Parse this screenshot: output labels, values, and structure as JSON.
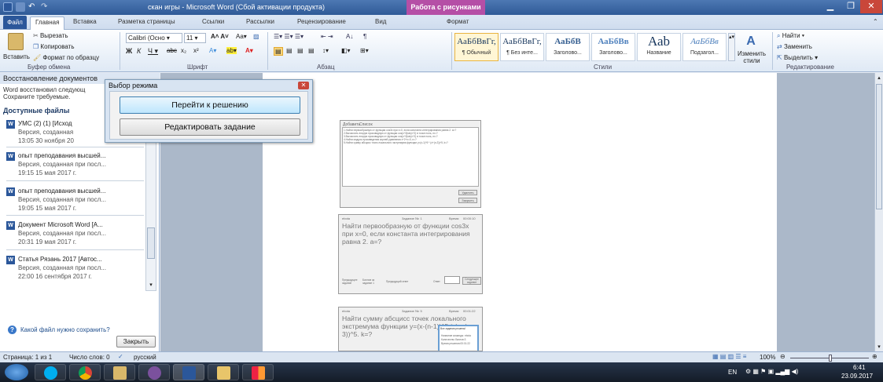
{
  "window": {
    "title": "скан игры - Microsoft Word (Сбой активации продукта)",
    "context_tab": "Работа с рисунками"
  },
  "tabs": [
    "Файл",
    "Главная",
    "Вставка",
    "Разметка страницы",
    "Ссылки",
    "Рассылки",
    "Рецензирование",
    "Вид",
    "Формат"
  ],
  "clipboard": {
    "paste": "Вставить",
    "cut": "Вырезать",
    "copy": "Копировать",
    "format_painter": "Формат по образцу",
    "label": "Буфер обмена"
  },
  "font": {
    "name": "Calibri (Осно",
    "size": "11",
    "label": "Шрифт"
  },
  "paragraph": {
    "label": "Абзац"
  },
  "styles": {
    "items": [
      {
        "sample": "АаБбВвГг,",
        "name": "¶ Обычный"
      },
      {
        "sample": "АаБбВвГг,",
        "name": "¶ Без инте..."
      },
      {
        "sample": "АаБбВ",
        "name": "Заголово..."
      },
      {
        "sample": "АаБбВв",
        "name": "Заголово..."
      },
      {
        "sample": "Ааb",
        "name": "Название"
      },
      {
        "sample": "АаБбВв",
        "name": "Подзагол..."
      }
    ],
    "change": "Изменить стили",
    "label": "Стили"
  },
  "editing": {
    "find": "Найти",
    "replace": "Заменить",
    "select": "Выделить",
    "label": "Редактирование"
  },
  "recovery": {
    "title": "Восстановление документов",
    "desc1": "Word восстановил следующ",
    "desc2": "Сохраните требуемые.",
    "available": "Доступные файлы",
    "files": [
      {
        "name": "УМС (2) (1) [Исход",
        "l2": "Версия, созданная",
        "l3": "13:05 30 ноября 20"
      },
      {
        "name": "опыт преподавания высшей...",
        "l2": "Версия, созданная при посл...",
        "l3": "19:15 15 мая 2017 г."
      },
      {
        "name": "опыт преподавания высшей...",
        "l2": "Версия, созданная при посл...",
        "l3": "19:05 15 мая 2017 г."
      },
      {
        "name": "Документ Microsoft Word [А...",
        "l2": "Версия, созданная при посл...",
        "l3": "20:31 19 мая 2017 г."
      },
      {
        "name": "Статья Рязань 2017 [Автос...",
        "l2": "Версия, созданная при посл...",
        "l3": "22:00 16 сентября 2017 г."
      }
    ],
    "help": "Какой файл нужно сохранить?",
    "close": "Закрыть"
  },
  "dialog": {
    "title": "Выбор режима",
    "btn1": "Перейти к решению",
    "btn2": "Редактировать задание"
  },
  "shot1": {
    "tab1": "Добавить",
    "tab2": "Список",
    "lines": [
      "1.Найти первообразную от функции cos3x при x=0, если константа интегрирования равна 2. a=?",
      "2.Вычислить вторую производную от функции cos(x^3)sin(x^2) в точке ноль, m=?",
      "3.Вычислить вторую производную от функции cos(x^3)sin(x^2) в точке ноль, m=?",
      "4.Найти модуль произведения корней уравнения x^2+x=0, n=?",
      "5.Найти сумму абсцисс точек локального экстремума функции y=(x-1)^5 * (x+(n-3))^5, k=?"
    ],
    "delete": "Удалить",
    "close": "Закрыть"
  },
  "shot2": {
    "head_left": "ebota",
    "head_mid": "Задание №: 1",
    "head_right": "Время:",
    "time": "00:00:10",
    "question": "Найти первообразную от функции cos3x при x=0, если константа интегрирования равна 2. a=?",
    "prev": "Предыдущее задание",
    "score": "Баллов за задание 1",
    "prev_answer": "Предыдущий ответ",
    "answer": "Ответ",
    "next": "Следующее задание"
  },
  "shot3": {
    "head_left": "ebota",
    "head_mid": "Задание №: 5",
    "head_right": "Время:",
    "time": "00:01:22",
    "question": "Найти сумму абсцисс точек локального экстремума функции y=(x-(n-1))^5 * (x+(n-3))^5. k=?",
    "popup_title": "Все задания решены!",
    "popup_l1": "Название команды: ebota",
    "popup_l2": "Количество баллов:3",
    "popup_l3": "Время решения:00:01:22"
  },
  "statusbar": {
    "page": "Страница: 1 из 1",
    "words": "Число слов: 0",
    "lang": "русский",
    "zoom": "100%"
  },
  "tray": {
    "lang": "EN",
    "time": "6:41",
    "date": "23.09.2017"
  }
}
